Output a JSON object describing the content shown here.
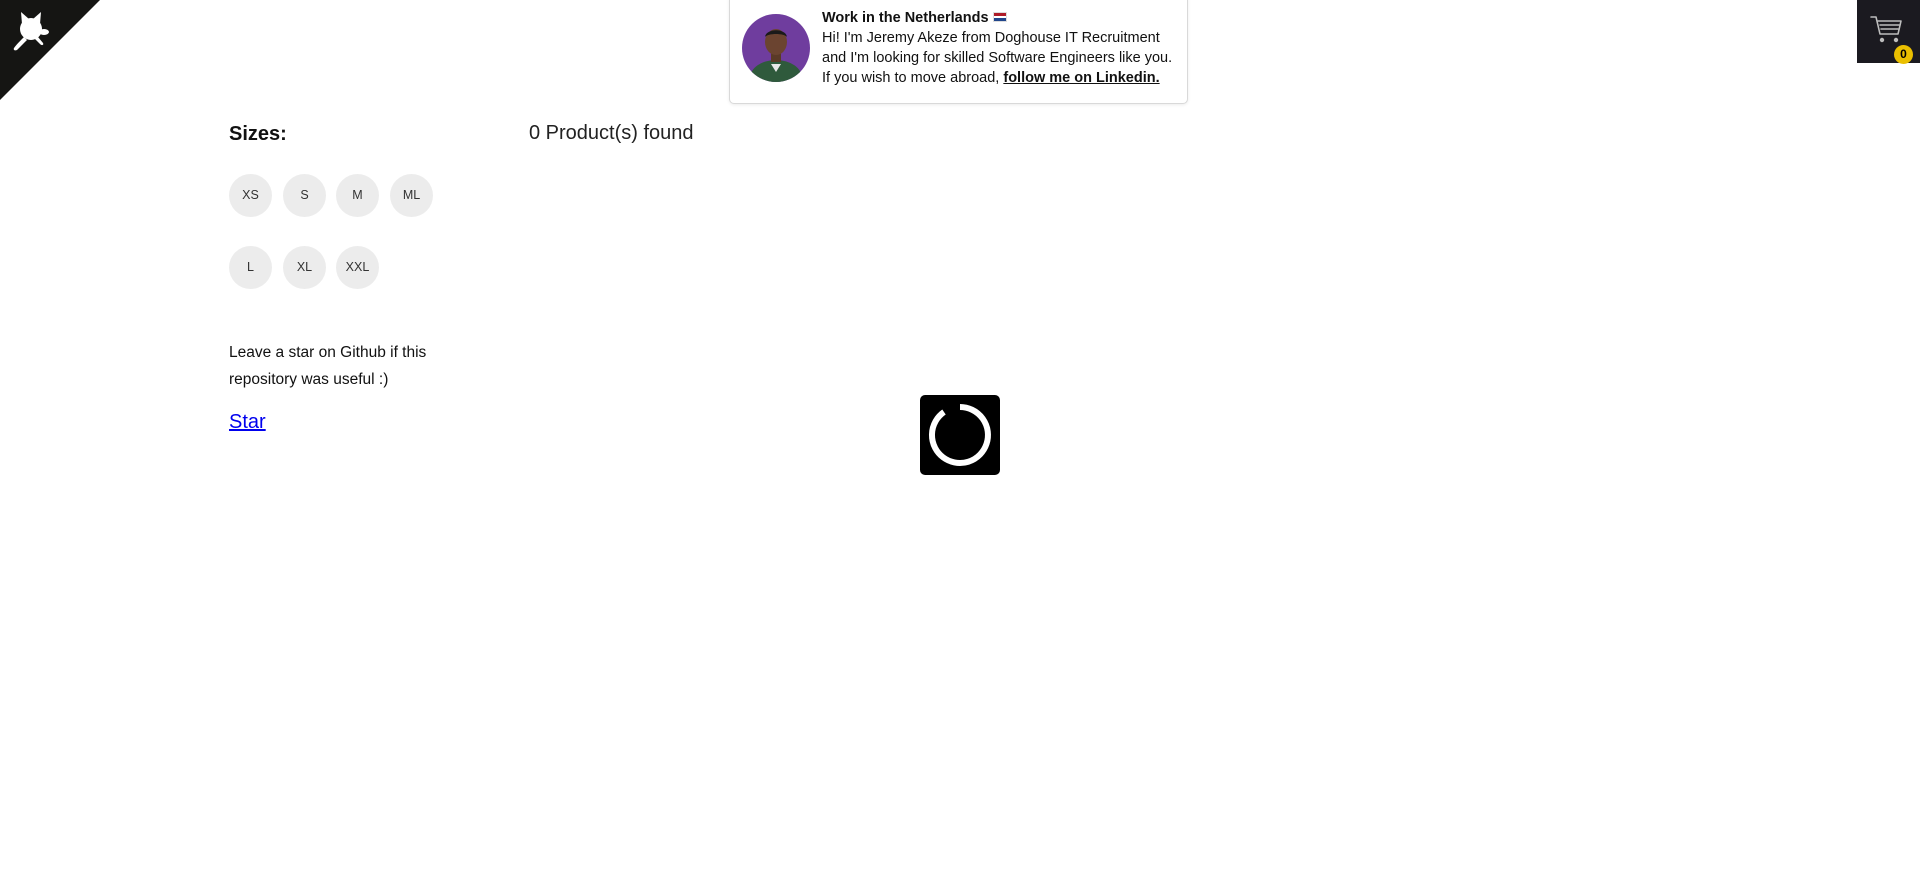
{
  "github_corner": {
    "icon": "github-octocat-icon"
  },
  "banner": {
    "title": "Work in the Netherlands",
    "flag_icon": "netherlands-flag-icon",
    "line1": "Hi! I'm Jeremy Akeze from Doghouse IT Recruitment",
    "line2": "and I'm looking for skilled Software Engineers like you.",
    "line3": "If you wish to move abroad,",
    "link_label": "follow me on Linkedin."
  },
  "cart": {
    "icon": "shopping-cart-icon",
    "count": "0"
  },
  "sidebar": {
    "sizes_title": "Sizes:",
    "sizes": [
      "XS",
      "S",
      "M",
      "ML",
      "L",
      "XL",
      "XXL"
    ],
    "star_note": "Leave a star on Github if this repository was useful :)",
    "star_label": "Star"
  },
  "main": {
    "product_count": "0 Product(s) found",
    "loader_icon": "loading-spinner-icon"
  },
  "colors": {
    "dark": "#1b1a20",
    "badge": "#eabf00",
    "size_bg": "#ececec",
    "link": "#0000ee"
  }
}
